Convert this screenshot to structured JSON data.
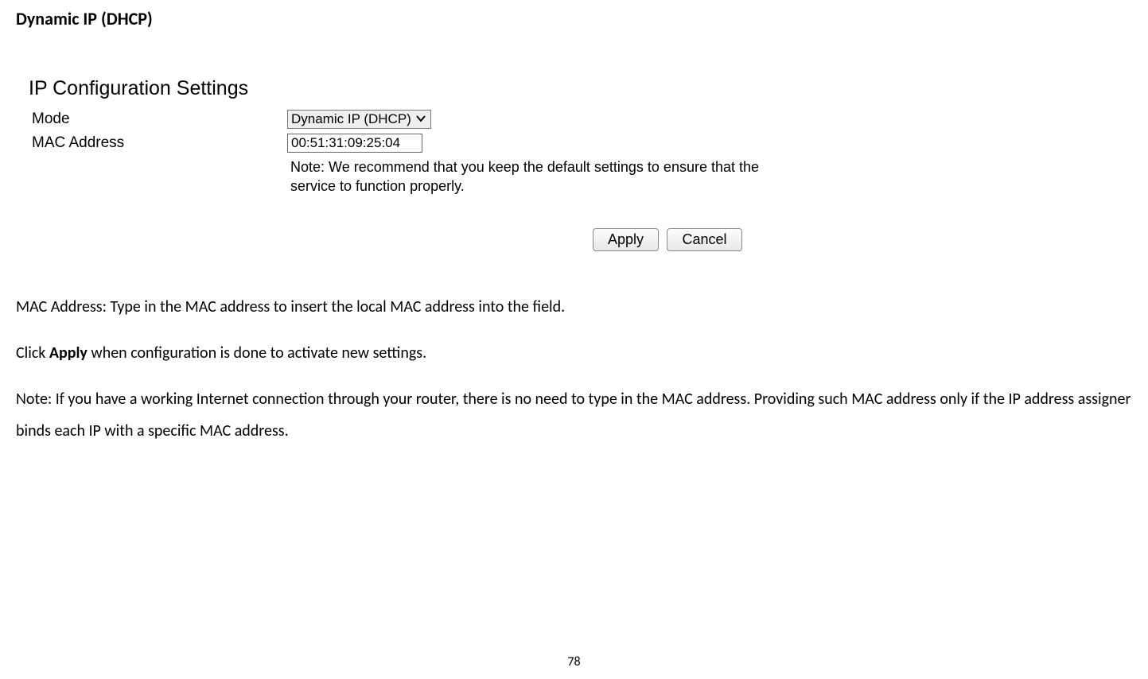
{
  "heading": "Dynamic IP (DHCP)",
  "screenshot": {
    "title": "IP Configuration Settings",
    "modeLabel": "Mode",
    "modeValue": "Dynamic IP (DHCP)",
    "macLabel": "MAC Address",
    "macValue": "00:51:31:09:25:04",
    "note": "Note: We recommend that you keep the default settings to ensure that the service to function properly.",
    "applyLabel": "Apply",
    "cancelLabel": "Cancel"
  },
  "paragraphs": {
    "p1": "MAC Address: Type in the MAC address to insert the local MAC address into the field.",
    "p2a": "Click ",
    "p2b": "Apply",
    "p2c": " when configuration is done to activate new settings.",
    "p3": "Note: If you have a working Internet connection through your router, there is no need to type in the MAC address. Providing such MAC address only if the IP address assigner binds each IP with a specific MAC address."
  },
  "pageNumber": "78"
}
